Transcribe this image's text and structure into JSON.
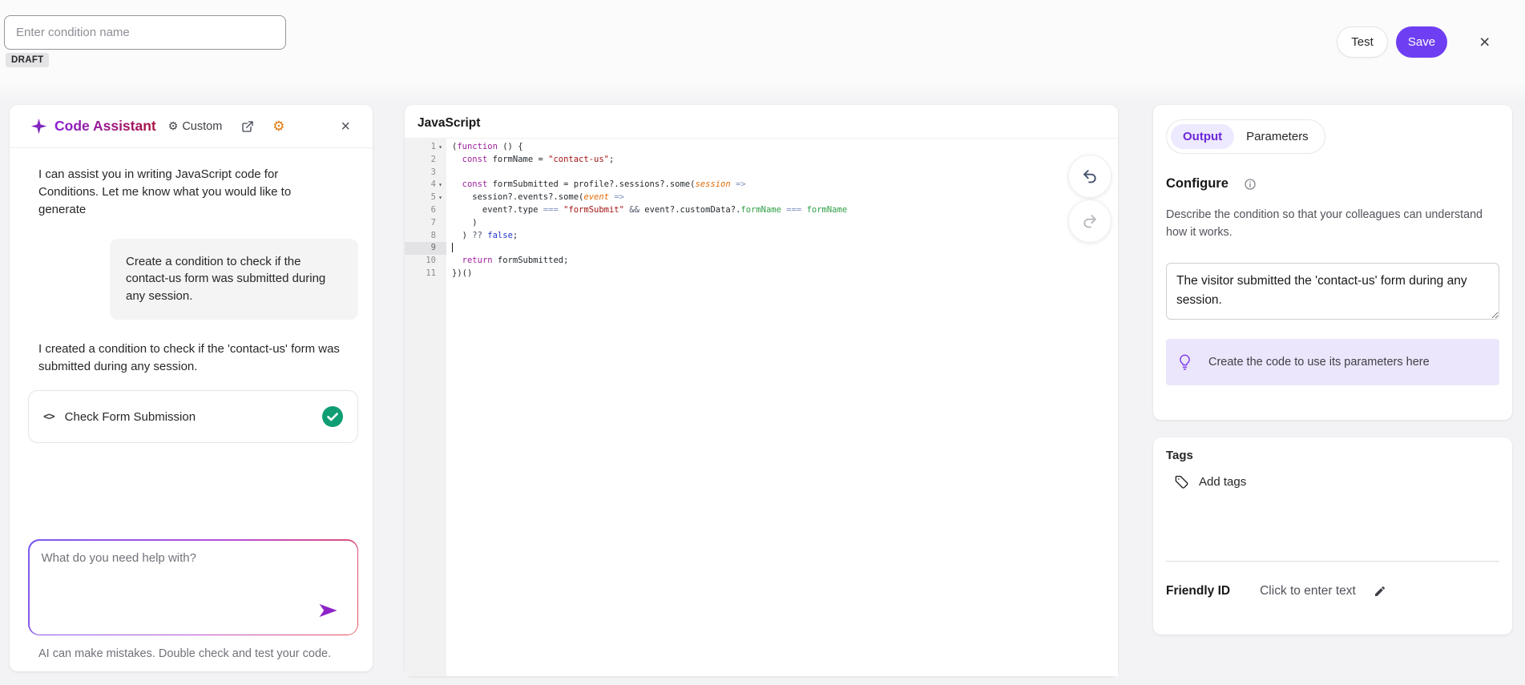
{
  "colors": {
    "accent": "#6e3ff2",
    "accent-light": "#ede9fe",
    "accent-text": "#6d28d9",
    "success": "#0f9d74",
    "title-grad-start": "#8a1fd6",
    "title-grad-end": "#ab1440",
    "tip-bg": "#ebe6fb",
    "code-plain": "#24292e",
    "code-keyword": "#9d1f9d",
    "code-string": "#a31111",
    "code-arg": "#e36c09",
    "code-op": "#7f92c0",
    "code-op-dark": "#4a5568",
    "code-prop": "#2f9e44",
    "code-atom": "#2336cc"
  },
  "topbar": {
    "name_input": {
      "placeholder": "Enter condition name",
      "value": ""
    },
    "draft_badge": "DRAFT",
    "test_button": "Test",
    "save_button": "Save"
  },
  "assistant": {
    "title": "Code Assistant",
    "mode_label": "Custom",
    "messages": {
      "welcome": "I can assist you in writing JavaScript code for Conditions. Let me know what you would like to generate",
      "user_request": "Create a condition to check if the contact-us form was submitted during any session.",
      "result": "I created a condition to check if the 'contact-us' form was submitted during any session."
    },
    "code_card_label": "Check Form Submission",
    "chat_input": {
      "placeholder": "What do you need help with?",
      "value": ""
    },
    "disclaimer": "AI can make mistakes. Double check and test your code."
  },
  "editor": {
    "title": "JavaScript",
    "active_line": 9,
    "lines": [
      {
        "n": 1,
        "fold": true,
        "tokens": [
          [
            "(",
            "p"
          ],
          [
            "function",
            "k"
          ],
          [
            " () {",
            "p"
          ]
        ]
      },
      {
        "n": 2,
        "tokens": [
          [
            "  ",
            "p"
          ],
          [
            "const",
            "k"
          ],
          [
            " formName = ",
            "p"
          ],
          [
            "\"contact-us\"",
            "s"
          ],
          [
            ";",
            "p"
          ]
        ]
      },
      {
        "n": 3,
        "tokens": []
      },
      {
        "n": 4,
        "fold": true,
        "tokens": [
          [
            "  ",
            "p"
          ],
          [
            "const",
            "k"
          ],
          [
            " formSubmitted = profile?.sessions?.some(",
            "p"
          ],
          [
            "session",
            "arg"
          ],
          [
            " ",
            "p"
          ],
          [
            "=>",
            "op"
          ]
        ]
      },
      {
        "n": 5,
        "fold": true,
        "tokens": [
          [
            "    session?.events?.some(",
            "p"
          ],
          [
            "event",
            "arg"
          ],
          [
            " ",
            "p"
          ],
          [
            "=>",
            "op"
          ]
        ]
      },
      {
        "n": 6,
        "tokens": [
          [
            "      event?.type ",
            "p"
          ],
          [
            "===",
            "op"
          ],
          [
            " ",
            "p"
          ],
          [
            "\"formSubmit\"",
            "s"
          ],
          [
            " ",
            "p"
          ],
          [
            "&&",
            "op2"
          ],
          [
            " event?.customData?.",
            "p"
          ],
          [
            "formName",
            "prop"
          ],
          [
            " ",
            "p"
          ],
          [
            "===",
            "op"
          ],
          [
            " ",
            "p"
          ],
          [
            "formName",
            "prop"
          ]
        ]
      },
      {
        "n": 7,
        "tokens": [
          [
            "    )",
            "p"
          ]
        ]
      },
      {
        "n": 8,
        "tokens": [
          [
            "  ) ",
            "p"
          ],
          [
            "??",
            "op2"
          ],
          [
            " ",
            "p"
          ],
          [
            "false",
            "atom"
          ],
          [
            ";",
            "p"
          ]
        ]
      },
      {
        "n": 9,
        "active": true,
        "cursor": true,
        "tokens": []
      },
      {
        "n": 10,
        "tokens": [
          [
            "  ",
            "p"
          ],
          [
            "return",
            "k"
          ],
          [
            " formSubmitted;",
            "p"
          ]
        ]
      },
      {
        "n": 11,
        "tokens": [
          [
            "})()",
            "p"
          ]
        ]
      }
    ]
  },
  "right": {
    "tabs": [
      {
        "label": "Output",
        "active": true
      },
      {
        "label": "Parameters",
        "active": false
      }
    ],
    "configure_heading": "Configure",
    "configure_description": "Describe the condition so that your colleagues can understand how it works.",
    "description_value": "The visitor submitted the 'contact-us' form during any session.",
    "tip_text": "Create the code to use its parameters here",
    "tags_heading": "Tags",
    "add_tags_label": "Add tags",
    "friendly_id_label": "Friendly ID",
    "friendly_id_placeholder": "Click to enter text"
  },
  "icons": {
    "gear": "⚙",
    "close": "×",
    "fold": "▾",
    "code": "<>"
  }
}
